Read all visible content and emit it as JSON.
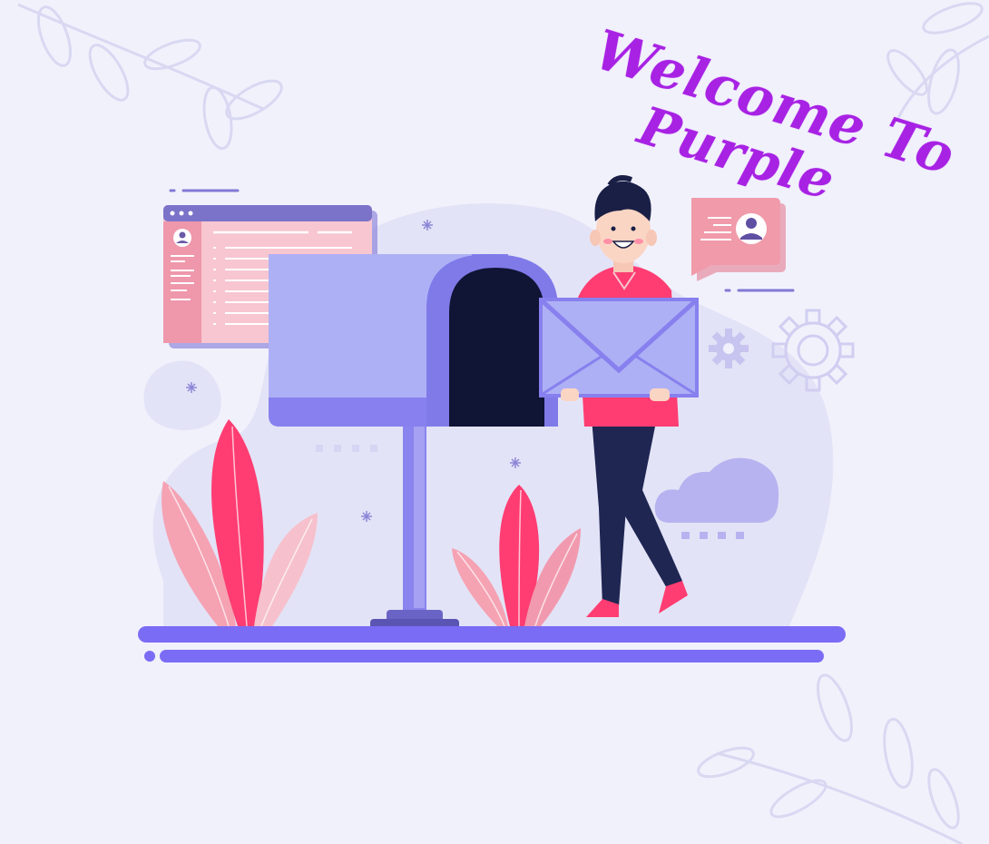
{
  "heading": {
    "line1": "Welcome To",
    "line2": "Purple"
  },
  "colors": {
    "background": "#f1f1fc",
    "heading": "#a722e3",
    "accent_purple": "#7b6cf5",
    "mailbox": "#aeb0f5",
    "pink": "#ff3d72",
    "dark_navy": "#1f2652"
  },
  "icons": [
    "leaf-branch",
    "browser-window",
    "mailbox",
    "envelope",
    "chat-bubble-user",
    "gear",
    "cloud",
    "plant"
  ]
}
